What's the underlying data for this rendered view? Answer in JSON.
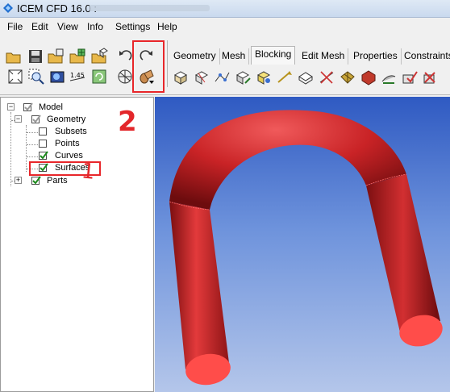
{
  "window": {
    "title": "ICEM CFD 16.0 :"
  },
  "menu": {
    "items": [
      "File",
      "Edit",
      "View",
      "Info",
      "Settings",
      "Help"
    ]
  },
  "tabs": [
    "Geometry",
    "Mesh",
    "Blocking",
    "Edit Mesh",
    "Properties",
    "Constraints"
  ],
  "active_tab": "Blocking",
  "tree": {
    "model": "Model",
    "geometry": "Geometry",
    "subsets": "Subsets",
    "points": "Points",
    "curves": "Curves",
    "surfaces": "Surfaces",
    "parts": "Parts"
  },
  "annotations": {
    "step1": "1",
    "step2": "2"
  },
  "colors": {
    "highlight": "#e8262a",
    "pipe": "#d8262a",
    "viewport_top": "#2f5ac2",
    "viewport_bottom": "#b4c6ea"
  }
}
